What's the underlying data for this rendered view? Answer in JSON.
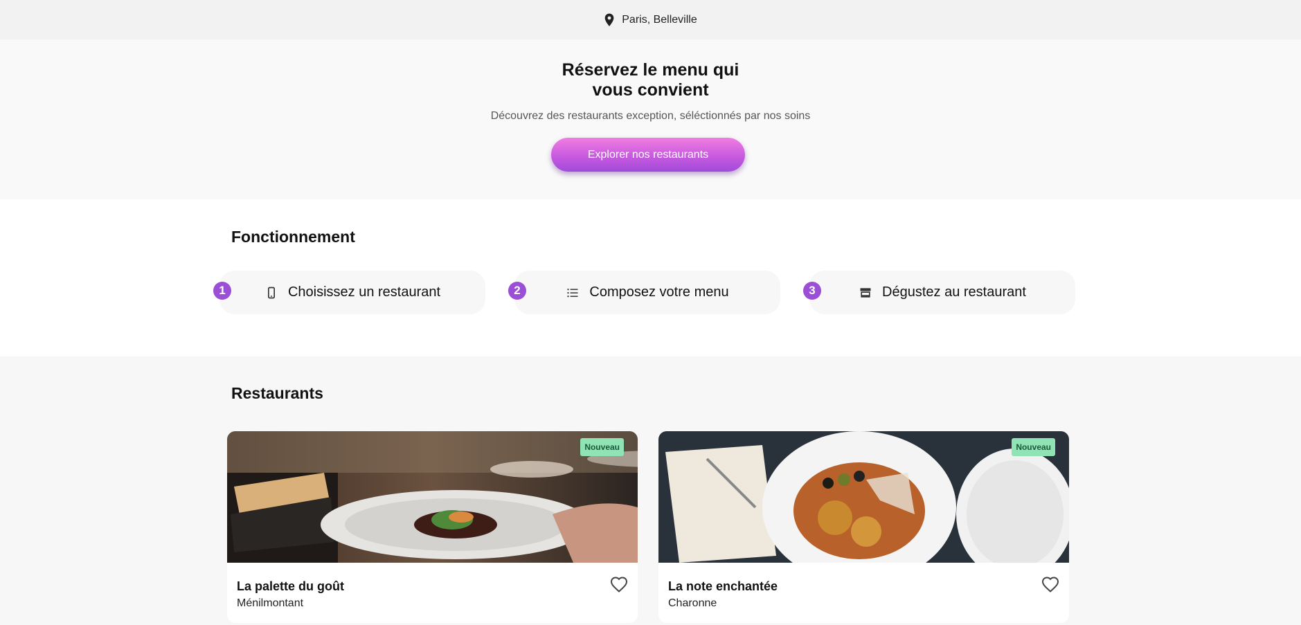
{
  "location": {
    "label": "Paris, Belleville",
    "icon": "map-pin-icon"
  },
  "hero": {
    "title_line1": "Réservez le menu qui",
    "title_line2": "vous convient",
    "subtitle": "Découvrez des restaurants exception, séléctionnés par nos soins",
    "cta_label": "Explorer nos restaurants"
  },
  "how": {
    "title": "Fonctionnement",
    "steps": [
      {
        "num": "1",
        "label": "Choisissez un restaurant",
        "icon": "smartphone-icon"
      },
      {
        "num": "2",
        "label": "Composez votre menu",
        "icon": "list-icon"
      },
      {
        "num": "3",
        "label": "Dégustez au restaurant",
        "icon": "storefront-icon"
      }
    ]
  },
  "restaurants": {
    "title": "Restaurants",
    "items": [
      {
        "name": "La palette du goût",
        "area": "Ménilmontant",
        "badge": "Nouveau"
      },
      {
        "name": "La note enchantée",
        "area": "Charonne",
        "badge": "Nouveau"
      }
    ]
  },
  "colors": {
    "accent_purple": "#9b4ed6",
    "badge_green": "#8fe3b5"
  }
}
